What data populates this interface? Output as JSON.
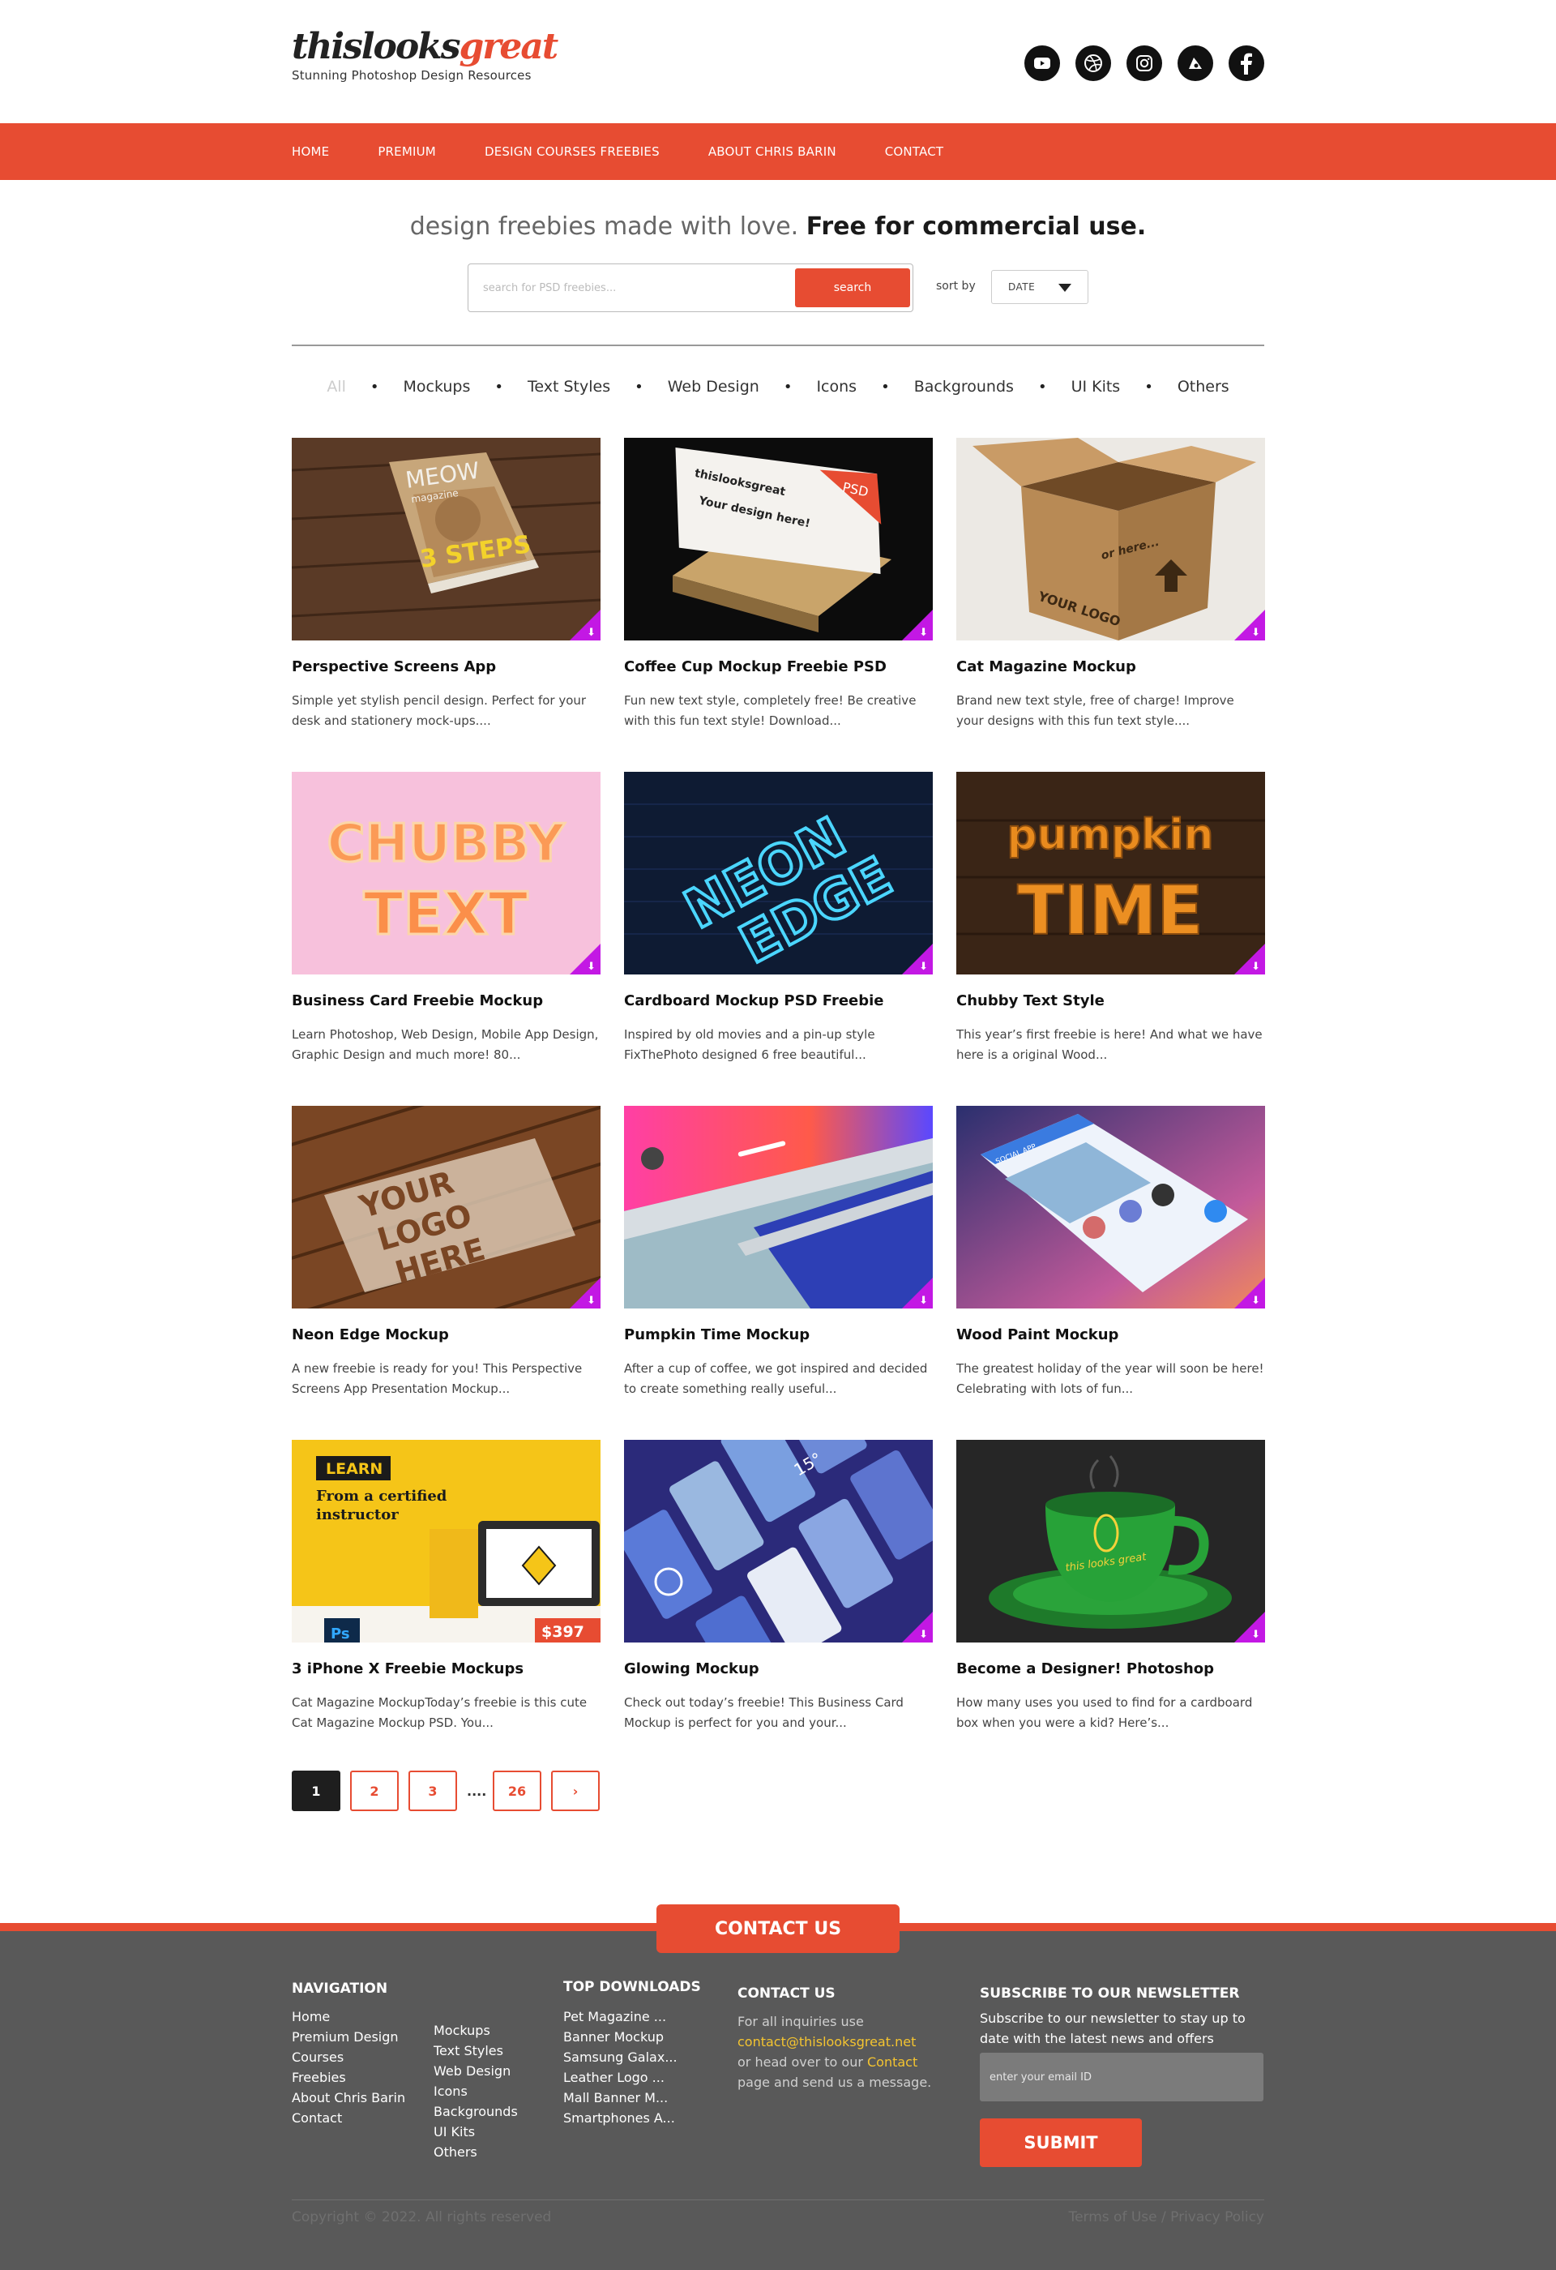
{
  "header": {
    "logo_dark": "thislooks",
    "logo_red": "great",
    "tagline": "Stunning Photoshop Design Resources",
    "socials": [
      "youtube-icon",
      "dribbble-icon",
      "instagram-icon",
      "behance-icon",
      "facebook-icon"
    ]
  },
  "nav": {
    "items": [
      "HOME",
      "PREMIUM",
      "DESIGN COURSES FREEBIES",
      "ABOUT CHRIS BARIN",
      "CONTACT"
    ]
  },
  "hero": {
    "tagline_light": "design freebies made with love.",
    "tagline_bold": "Free for commercial use.",
    "search_placeholder": "search for PSD freebies...",
    "search_button": "search",
    "sort_label": "sort by",
    "sort_value": "DATE"
  },
  "filters": [
    "All",
    "Mockups",
    "Text Styles",
    "Web Design",
    "Icons",
    "Backgrounds",
    "UI Kits",
    "Others"
  ],
  "cards": [
    {
      "title": "Perspective Screens App",
      "desc": "Simple yet stylish pencil design. Perfect for your desk and stationery mock-ups....",
      "thumb_labels": [
        "MEOW",
        "magazine",
        "3 STEPS"
      ]
    },
    {
      "title": "Coffee Cup Mockup Freebie PSD",
      "desc": "Fun new text style, completely free! Be creative with this fun text style! Download...",
      "thumb_labels": [
        "thislooksgreat",
        "PSD",
        "Your design here!"
      ]
    },
    {
      "title": "Cat Magazine Mockup",
      "desc": "Brand new text style, free of charge! Improve your designs with this fun text style....",
      "thumb_labels": [
        "or here...",
        "YOUR LOGO"
      ]
    },
    {
      "title": "Business Card Freebie Mockup",
      "desc": "Learn Photoshop, Web Design, Mobile App Design, Graphic Design and much more! 80...",
      "thumb_labels": [
        "CHUBBY",
        "TEXT"
      ]
    },
    {
      "title": "Cardboard Mockup PSD Freebie",
      "desc": "Inspired by old movies and a pin-up style FixThePhoto designed 6 free beautiful...",
      "thumb_labels": [
        "NEON",
        "EDGE"
      ]
    },
    {
      "title": "Chubby Text Style",
      "desc": "This year’s first freebie is here! And what we have here is a original Wood...",
      "thumb_labels": [
        "pumpkin",
        "TIME"
      ]
    },
    {
      "title": "Neon Edge Mockup",
      "desc": "A new freebie is ready for you! This Perspective Screens App Presentation Mockup...",
      "thumb_labels": [
        "YOUR",
        "LOGO",
        "HERE"
      ]
    },
    {
      "title": "Pumpkin Time Mockup",
      "desc": "After a cup of coffee, we got inspired and decided to create something really useful...",
      "thumb_labels": []
    },
    {
      "title": "Wood Paint Mockup",
      "desc": "The greatest holiday of the year will soon be here! Celebrating with lots of fun...",
      "thumb_labels": [
        "SOCIAL APP"
      ]
    },
    {
      "title": "3 iPhone X Freebie Mockups",
      "desc": "Cat Magazine MockupToday’s freebie is this cute Cat Magazine Mockup PSD. You...",
      "thumb_labels": [
        "LEARN",
        "From a certified",
        "instructor",
        "$397",
        "Ps"
      ]
    },
    {
      "title": "Glowing Mockup",
      "desc": "Check out today’s freebie! This Business Card Mockup is perfect for you and your...",
      "thumb_labels": [
        "15°"
      ]
    },
    {
      "title": "Become a Designer! Photoshop",
      "desc": "How many uses you used to find for a cardboard box when you were a kid? Here’s...",
      "thumb_labels": [
        "this looks great"
      ]
    }
  ],
  "pagination": {
    "pages": [
      "1",
      "2",
      "3"
    ],
    "ellipsis": "....",
    "last": "26",
    "next": "›",
    "current": "1"
  },
  "footer": {
    "contact_tab": "CONTACT US",
    "navigation": {
      "title": "NAVIGATION",
      "col1": [
        "Home",
        "Premium Design",
        "Courses",
        "Freebies",
        "About Chris Barin",
        "Contact"
      ],
      "col2": [
        "Mockups",
        "Text Styles",
        "Web Design",
        "Icons",
        "Backgrounds",
        "UI Kits",
        "Others"
      ]
    },
    "downloads": {
      "title": "TOP DOWNLOADS",
      "items": [
        "Pet Magazine ...",
        "Banner Mockup",
        "Samsung Galax...",
        "Leather Logo ...",
        "Mall Banner M...",
        "Smartphones A..."
      ]
    },
    "contact": {
      "title": "CONTACT US",
      "line1": "For all inquiries use",
      "email": "contact@thislooksgreat.net",
      "line3_pre": "or head over to our",
      "line3_link": "Contact",
      "line4": "page and send us a message."
    },
    "newsletter": {
      "title": "SUBSCRIBE TO OUR NEWSLETTER",
      "line1": "Subscribe to our newsletter to stay up to",
      "line2": "date with the latest news and offers",
      "placeholder": "enter your email ID",
      "submit": "SUBMIT"
    },
    "copyright": "Copyright © 2022. All rights reserved",
    "legal": "Terms of Use / Privacy Policy"
  },
  "colors": {
    "accent": "#e74c32",
    "footer_bg": "#595959",
    "badge": "#c318e4",
    "link_yellow": "#f4c430"
  }
}
